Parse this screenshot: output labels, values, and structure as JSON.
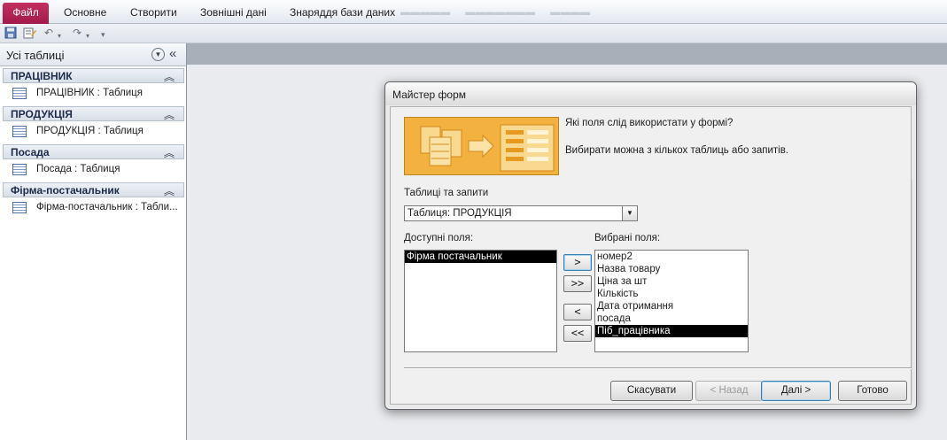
{
  "ribbon": {
    "file_tab": "Файл",
    "tabs": [
      "Основне",
      "Створити",
      "Зовнішні дані",
      "Знаряддя бази даних"
    ]
  },
  "nav_pane": {
    "title": "Усі таблиці",
    "groups": [
      {
        "title": "ПРАЦІВНИК",
        "items": [
          "ПРАЦІВНИК : Таблиця"
        ]
      },
      {
        "title": "ПРОДУКЦІЯ",
        "items": [
          "ПРОДУКЦІЯ : Таблиця"
        ]
      },
      {
        "title": "Посада",
        "items": [
          "Посада : Таблиця"
        ]
      },
      {
        "title": "Фірма-постачальник",
        "items": [
          "Фірма-постачальник : Табли..."
        ]
      }
    ]
  },
  "dialog": {
    "title": "Майстер форм",
    "question": "Які поля слід використати у формі?",
    "hint": "Вибирати можна з кількох таблиць або запитів.",
    "tables_label": "Таблиці та запити",
    "selected_table": "Таблиця: ПРОДУКЦІЯ",
    "available_label": "Доступні поля:",
    "available_fields": [
      {
        "name": "Фірма постачальник",
        "selected": true
      }
    ],
    "chosen_label": "Вибрані поля:",
    "chosen_fields": [
      {
        "name": "номер2",
        "selected": false
      },
      {
        "name": "Назва товару",
        "selected": false
      },
      {
        "name": "Ціна за шт",
        "selected": false
      },
      {
        "name": "Кількість",
        "selected": false
      },
      {
        "name": "Дата отримання",
        "selected": false
      },
      {
        "name": "посада",
        "selected": false
      },
      {
        "name": "Піб_працівника",
        "selected": true
      }
    ],
    "move_buttons": {
      "add_one": ">",
      "add_all": ">>",
      "remove_one": "<",
      "remove_all": "<<"
    },
    "buttons": {
      "cancel": "Скасувати",
      "back": "< Назад",
      "next": "Далі >",
      "finish": "Готово"
    }
  },
  "icons": {
    "save": "save-icon",
    "layout": "layout-view-icon",
    "undo": "undo-icon",
    "redo": "redo-icon",
    "customize": "customize-qat-icon",
    "table": "table-icon"
  },
  "colors": {
    "file_tab": "#b02556",
    "workspace": "#e9ebee",
    "banner": "#f0b03c",
    "selection": "#000000"
  }
}
